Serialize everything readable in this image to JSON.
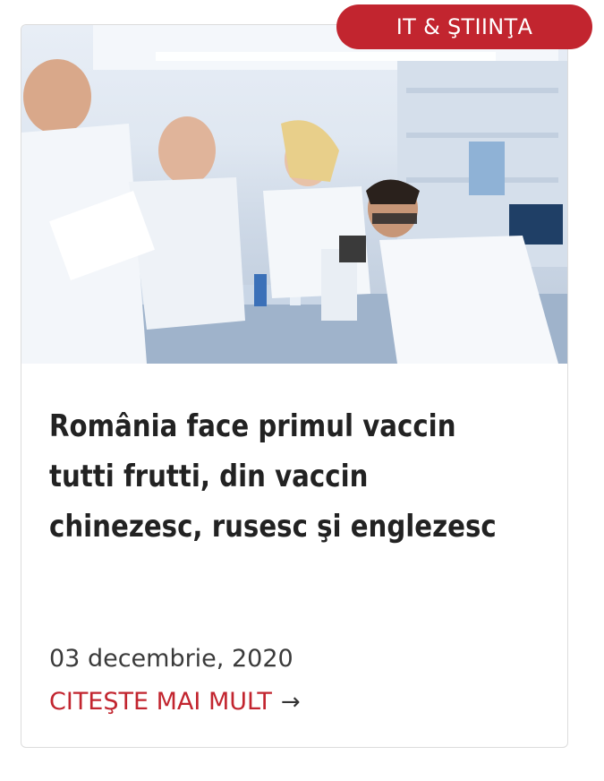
{
  "badge": {
    "label": "IT & ŞTIINŢA",
    "color": "#c2252f"
  },
  "article": {
    "image_alt": "scientists-in-laboratory",
    "title_lines": [
      "România face primul vaccin",
      "tutti frutti, din vaccin",
      "chinezesc, rusesc şi englezesc"
    ],
    "date": "03 decembrie, 2020",
    "read_more_label": "CITEŞTE MAI MULT",
    "read_more_icon": "arrow-right-icon"
  }
}
